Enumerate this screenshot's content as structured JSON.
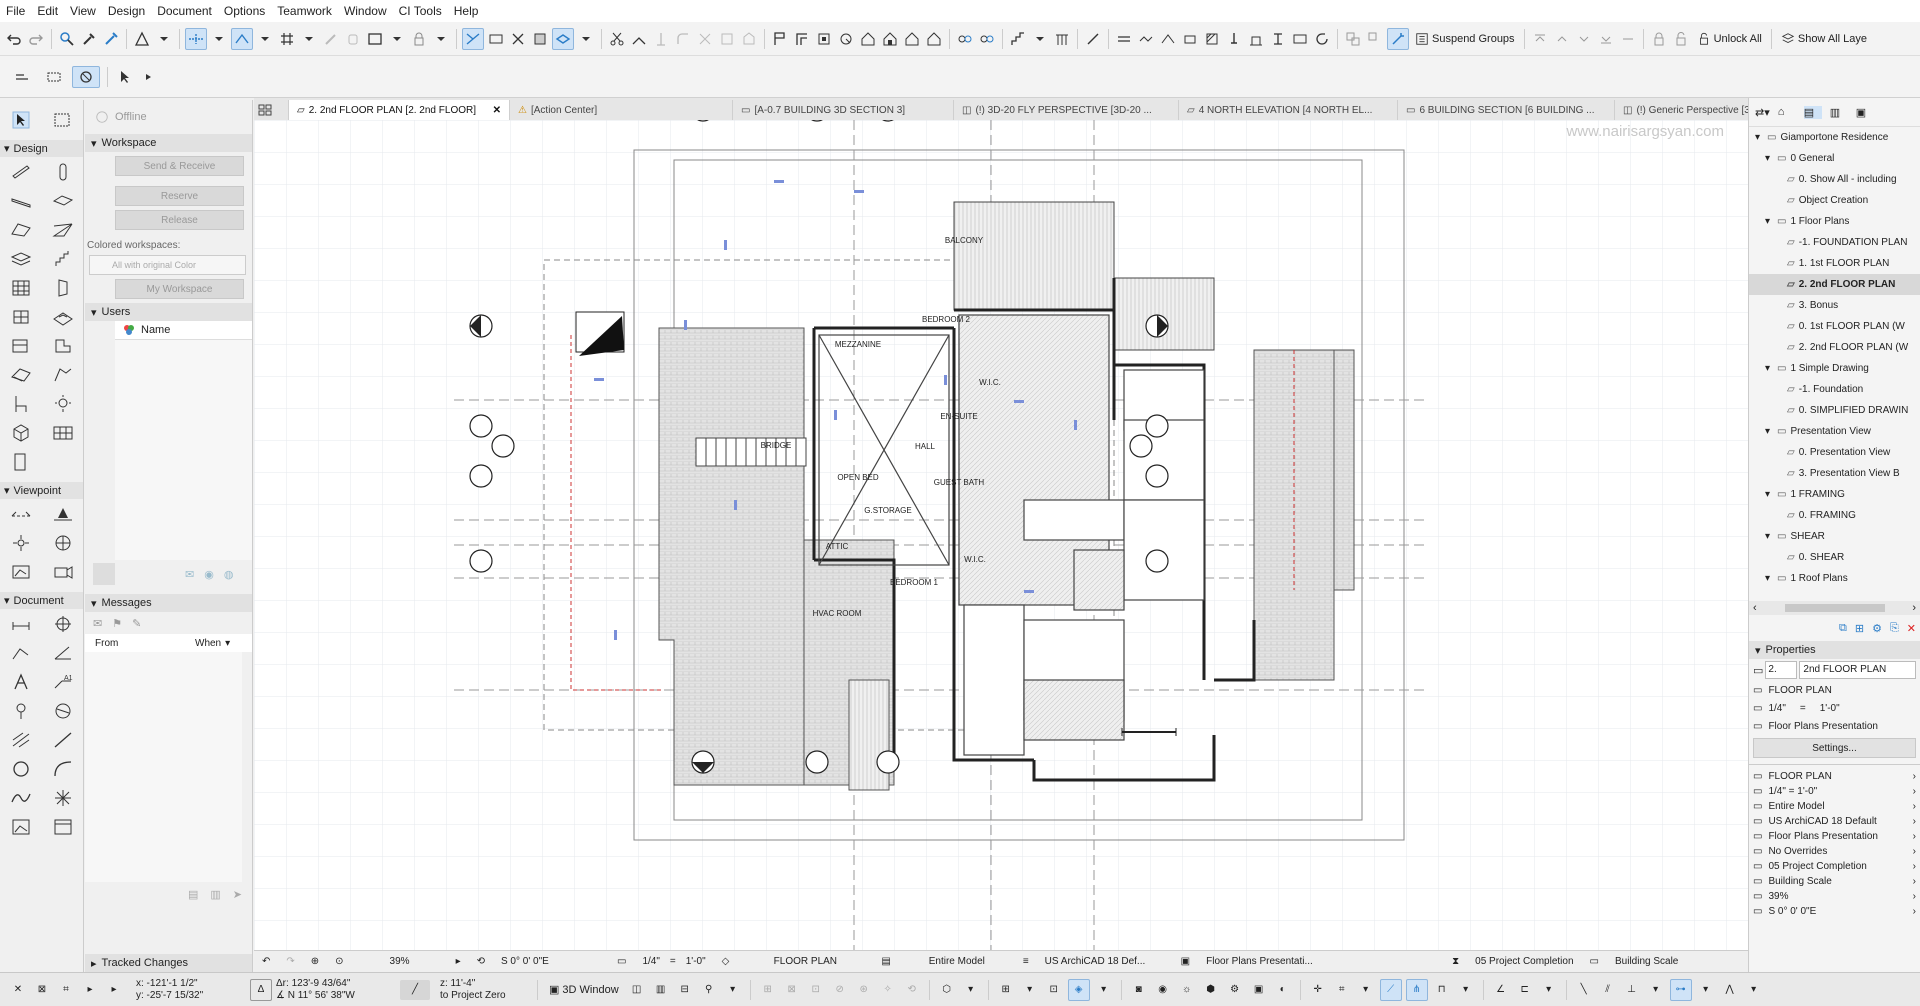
{
  "menu": [
    "File",
    "Edit",
    "View",
    "Design",
    "Document",
    "Options",
    "Teamwork",
    "Window",
    "CI Tools",
    "Help"
  ],
  "toolbar": {
    "suspend_groups": "Suspend Groups",
    "unlock_all": "Unlock All",
    "show_all_layers": "Show All Laye"
  },
  "toolbox": {
    "design": "Design",
    "viewpoint": "Viewpoint",
    "document": "Document"
  },
  "teamwork": {
    "status": "Offline",
    "workspace": "Workspace",
    "send_receive": "Send & Receive",
    "reserve": "Reserve",
    "release": "Release",
    "colored_workspaces": "Colored workspaces:",
    "color_option": "All with original Color",
    "my_workspace": "My Workspace",
    "users": "Users",
    "name_col": "Name",
    "messages": "Messages",
    "from_col": "From",
    "when_col": "When",
    "tracked_changes": "Tracked Changes"
  },
  "tabs": [
    {
      "label": "2. 2nd FLOOR PLAN [2. 2nd FLOOR]",
      "active": true
    },
    {
      "label": "[Action Center]"
    },
    {
      "label": "[A-0.7 BUILDING 3D SECTION 3]"
    },
    {
      "label": "(!) 3D-20 FLY PERSPECTIVE [3D-20 ..."
    },
    {
      "label": "4 NORTH ELEVATION [4 NORTH EL..."
    },
    {
      "label": "6 BUILDING SECTION [6 BUILDING ..."
    },
    {
      "label": "(!) Generic Perspective [3D / All]"
    }
  ],
  "canvas": {
    "watermark": "www.nairisargsyan.com",
    "rooms": [
      "BALCONY",
      "BEDROOM 2",
      "MEZZANINE",
      "W.I.C.",
      "EN-SUITE",
      "BRIDGE",
      "HALL",
      "OPEN BED",
      "GUEST BATH",
      "G.STORAGE",
      "ATTIC",
      "BEDROOM 1",
      "HVAC ROOM",
      "W.I.C."
    ]
  },
  "navigator": {
    "items": [
      {
        "label": "Giamportone Residence",
        "level": 0
      },
      {
        "label": "0 General",
        "level": 1
      },
      {
        "label": "0. Show All - including",
        "level": 2
      },
      {
        "label": "Object Creation",
        "level": 2
      },
      {
        "label": "1 Floor Plans",
        "level": 1
      },
      {
        "label": "-1. FOUNDATION PLAN",
        "level": 2
      },
      {
        "label": "1. 1st FLOOR PLAN",
        "level": 2
      },
      {
        "label": "2. 2nd FLOOR PLAN",
        "level": 2,
        "selected": true
      },
      {
        "label": "3. Bonus",
        "level": 2
      },
      {
        "label": "0. 1st FLOOR PLAN (W",
        "level": 2
      },
      {
        "label": "2. 2nd FLOOR PLAN (W",
        "level": 2
      },
      {
        "label": "1 Simple Drawing",
        "level": 1
      },
      {
        "label": "-1. Foundation",
        "level": 2
      },
      {
        "label": "0. SIMPLIFIED DRAWIN",
        "level": 2
      },
      {
        "label": "Presentation View",
        "level": 1
      },
      {
        "label": "0. Presentation View",
        "level": 2
      },
      {
        "label": "3. Presentation View B",
        "level": 2
      },
      {
        "label": "1 FRAMING",
        "level": 1
      },
      {
        "label": "0. FRAMING",
        "level": 2
      },
      {
        "label": "SHEAR",
        "level": 1
      },
      {
        "label": "0. SHEAR",
        "level": 2
      },
      {
        "label": "1 Roof Plans",
        "level": 1
      }
    ],
    "properties_title": "Properties",
    "id_value": "2.",
    "name_value": "2nd FLOOR PLAN",
    "type": "FLOOR PLAN",
    "scale_left": "1/4\"",
    "scale_eq": "=",
    "scale_right": "1'-0\"",
    "pen_set": "Floor Plans Presentation",
    "settings": "Settings...",
    "props": [
      "FLOOR PLAN",
      "1/4\"   =   1'-0\"",
      "Entire Model",
      "US ArchiCAD 18 Default",
      "Floor Plans Presentation",
      "No Overrides",
      "05 Project Completion",
      "Building Scale",
      "39%",
      "S 0° 0' 0\"E"
    ]
  },
  "status": {
    "zoom": "39%",
    "angle": "S 0° 0' 0\"E",
    "scale_a": "1/4\"",
    "scale_eq": "=",
    "scale_b": "1'-0\"",
    "view_type": "FLOOR PLAN",
    "model": "Entire Model",
    "penset": "US ArchiCAD 18 Def...",
    "graphic": "Floor Plans Presentati...",
    "phase": "05 Project Completion",
    "building_scale": "Building Scale"
  },
  "coords": {
    "x": "x: -121'-1 1/2\"",
    "y": "y: -25'-7 15/32\"",
    "dr": "Δr: 123'-9 43/64\"",
    "bearing": "∡ N 11° 56' 38\"W",
    "z": "z: 11'-4\"",
    "ref": "to Project Zero",
    "window3d": "3D Window"
  },
  "accent": "#2a7cc7"
}
